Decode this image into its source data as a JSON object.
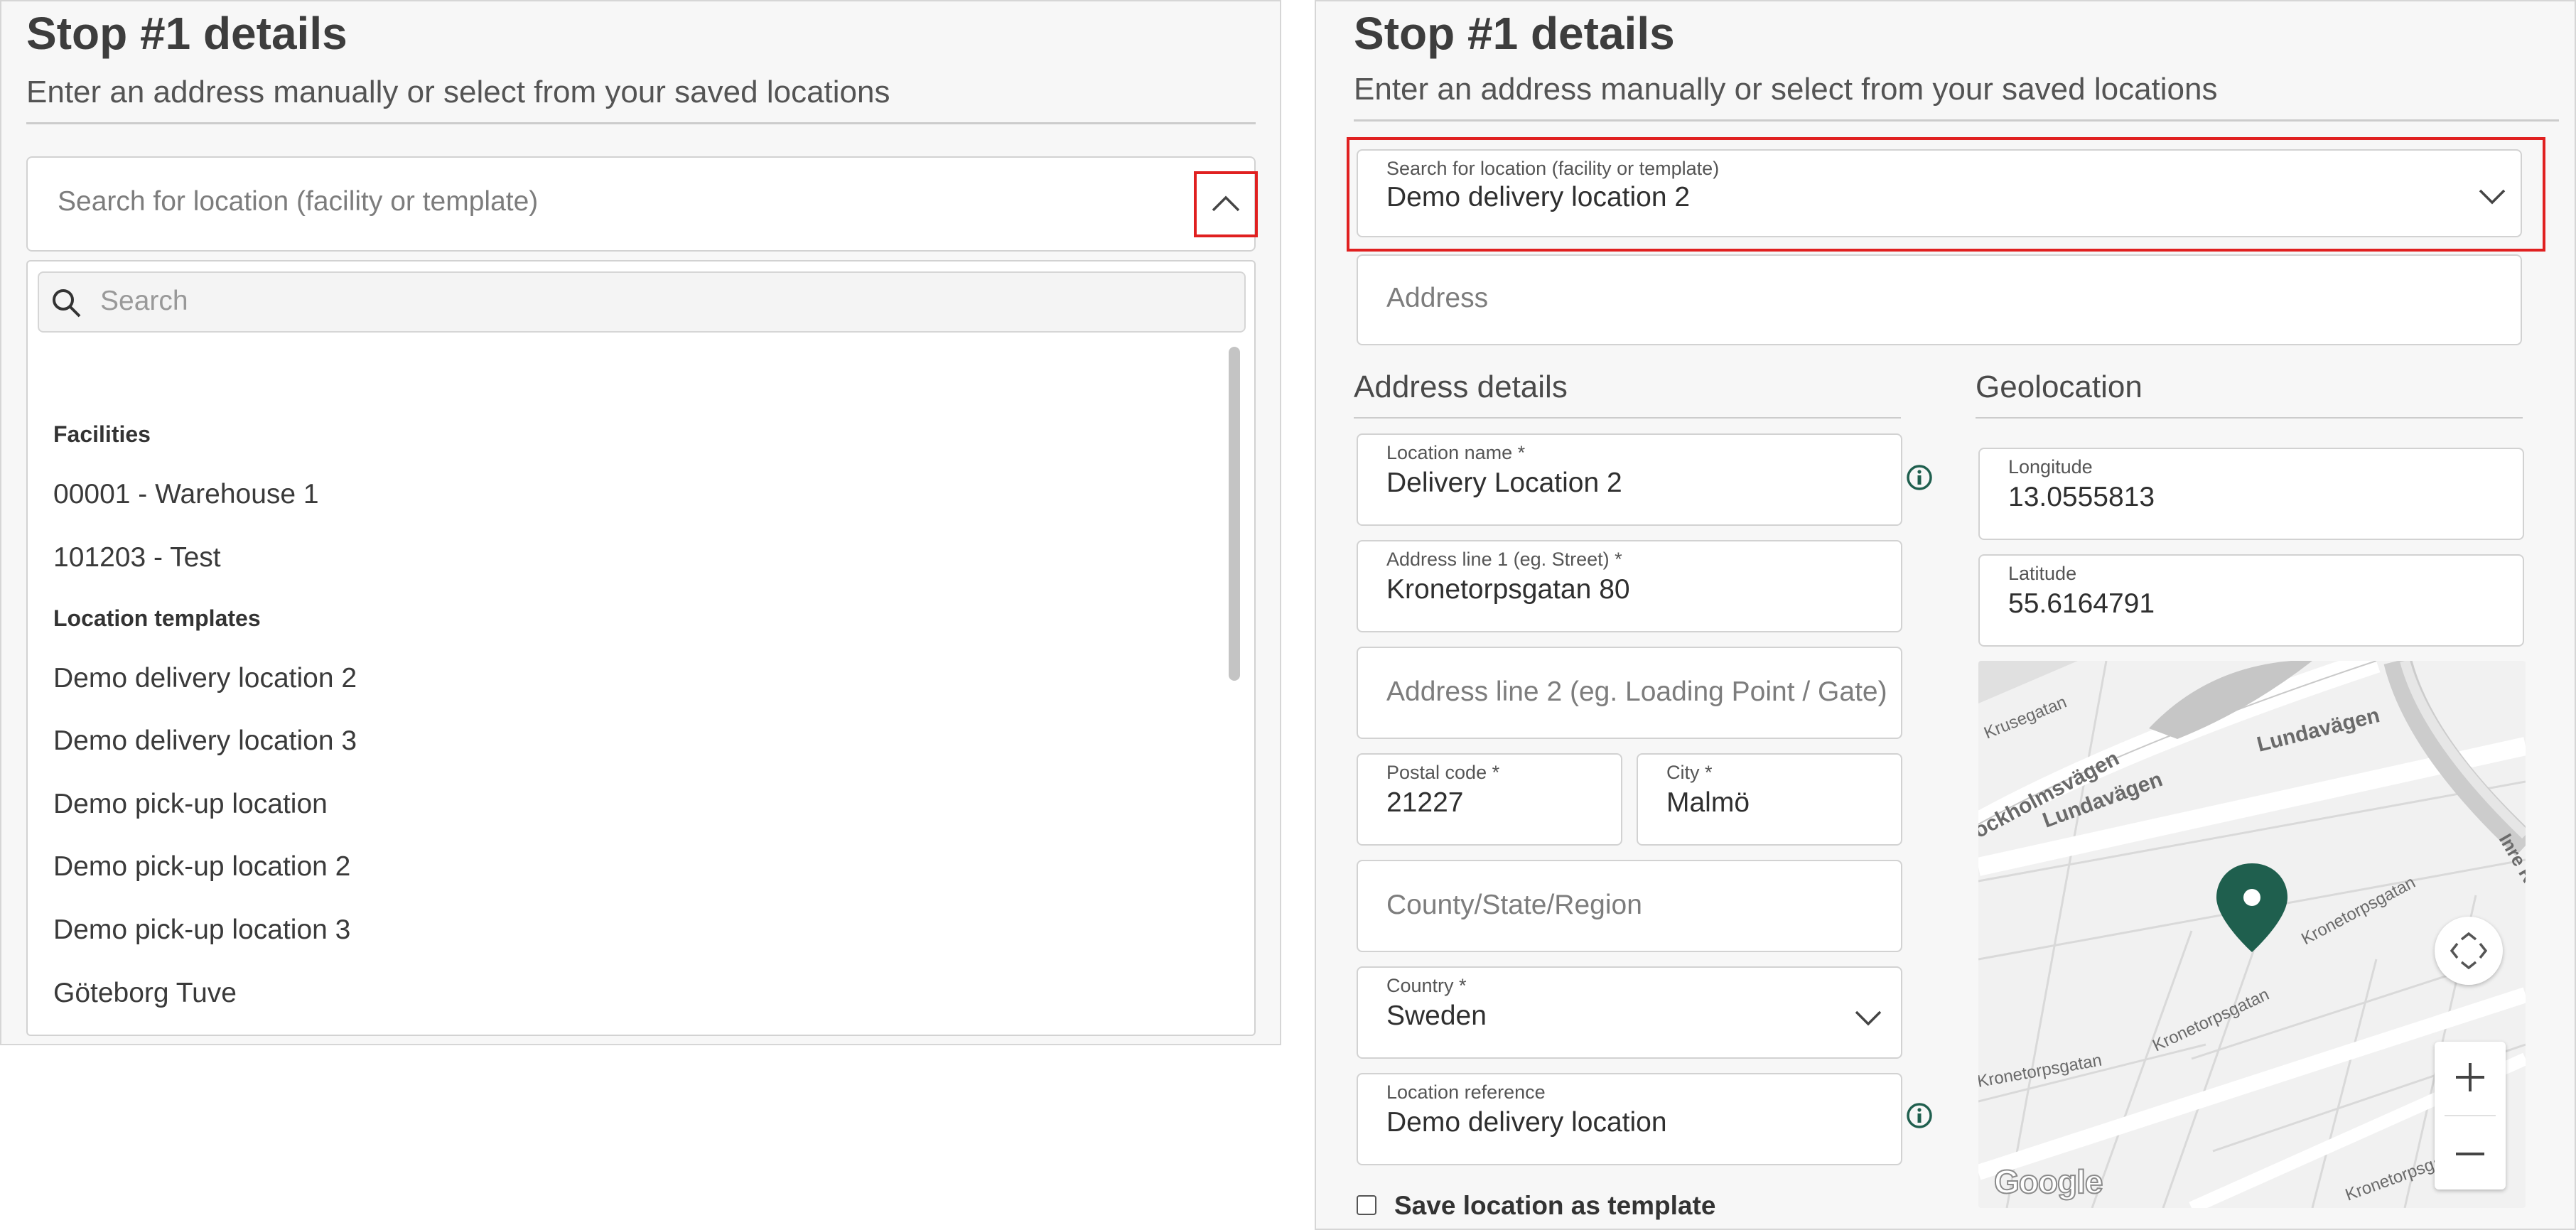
{
  "left": {
    "title": "Stop #1 details",
    "subtitle": "Enter an address manually or select from your saved locations",
    "search_location": {
      "placeholder": "Search for location (facility or template)"
    },
    "dropdown": {
      "search_placeholder": "Search",
      "groups": [
        {
          "label": "Facilities",
          "items": [
            "00001 - Warehouse 1",
            "101203 - Test"
          ]
        },
        {
          "label": "Location templates",
          "items": [
            "Demo delivery location 2",
            "Demo delivery location 3",
            "Demo pick-up location",
            "Demo pick-up location 2",
            "Demo pick-up location 3",
            "Göteborg Tuve"
          ]
        }
      ],
      "scroll_position": 0.0
    },
    "chevron_icon": "chevron-up-icon"
  },
  "right": {
    "title": "Stop #1 details",
    "subtitle": "Enter an address manually or select from your saved locations",
    "search_location": {
      "label": "Search for location (facility or template)",
      "value": "Demo delivery location 2"
    },
    "address": {
      "placeholder": "Address"
    },
    "address_details": {
      "heading": "Address details",
      "location_name": {
        "label": "Location name *",
        "value": "Delivery Location 2"
      },
      "address_line1": {
        "label": "Address line 1 (eg. Street) *",
        "value": "Kronetorpsgatan 80"
      },
      "address_line2": {
        "placeholder": "Address line 2 (eg. Loading Point / Gate)"
      },
      "postal_code": {
        "label": "Postal code *",
        "value": "21227"
      },
      "city": {
        "label": "City *",
        "value": "Malmö"
      },
      "county": {
        "placeholder": "County/State/Region"
      },
      "country": {
        "label": "Country *",
        "value": "Sweden"
      },
      "location_reference": {
        "label": "Location reference",
        "value": "Demo delivery location"
      }
    },
    "geolocation": {
      "heading": "Geolocation",
      "longitude": {
        "label": "Longitude",
        "value": "13.0555813"
      },
      "latitude": {
        "label": "Latitude",
        "value": "55.6164791"
      }
    },
    "map": {
      "streets": [
        "Krusegatan",
        "Lundavägen",
        "Lundavägen",
        "ockholmsvägen",
        "Kronetorpsgatan",
        "Kronetorpsgatan",
        "Kronetorpsgatan",
        "Kronetorpsgatan",
        "Inre R"
      ],
      "logo": "Google",
      "marker_color": "#1f5f4e",
      "icons": [
        "fullscreen-icon",
        "zoom-in-icon",
        "zoom-out-icon",
        "map-pin-icon"
      ]
    },
    "save_template": {
      "label": "Save location as template",
      "checked": false
    }
  },
  "colors": {
    "highlight": "#e02020",
    "info": "#1f5f4e"
  }
}
